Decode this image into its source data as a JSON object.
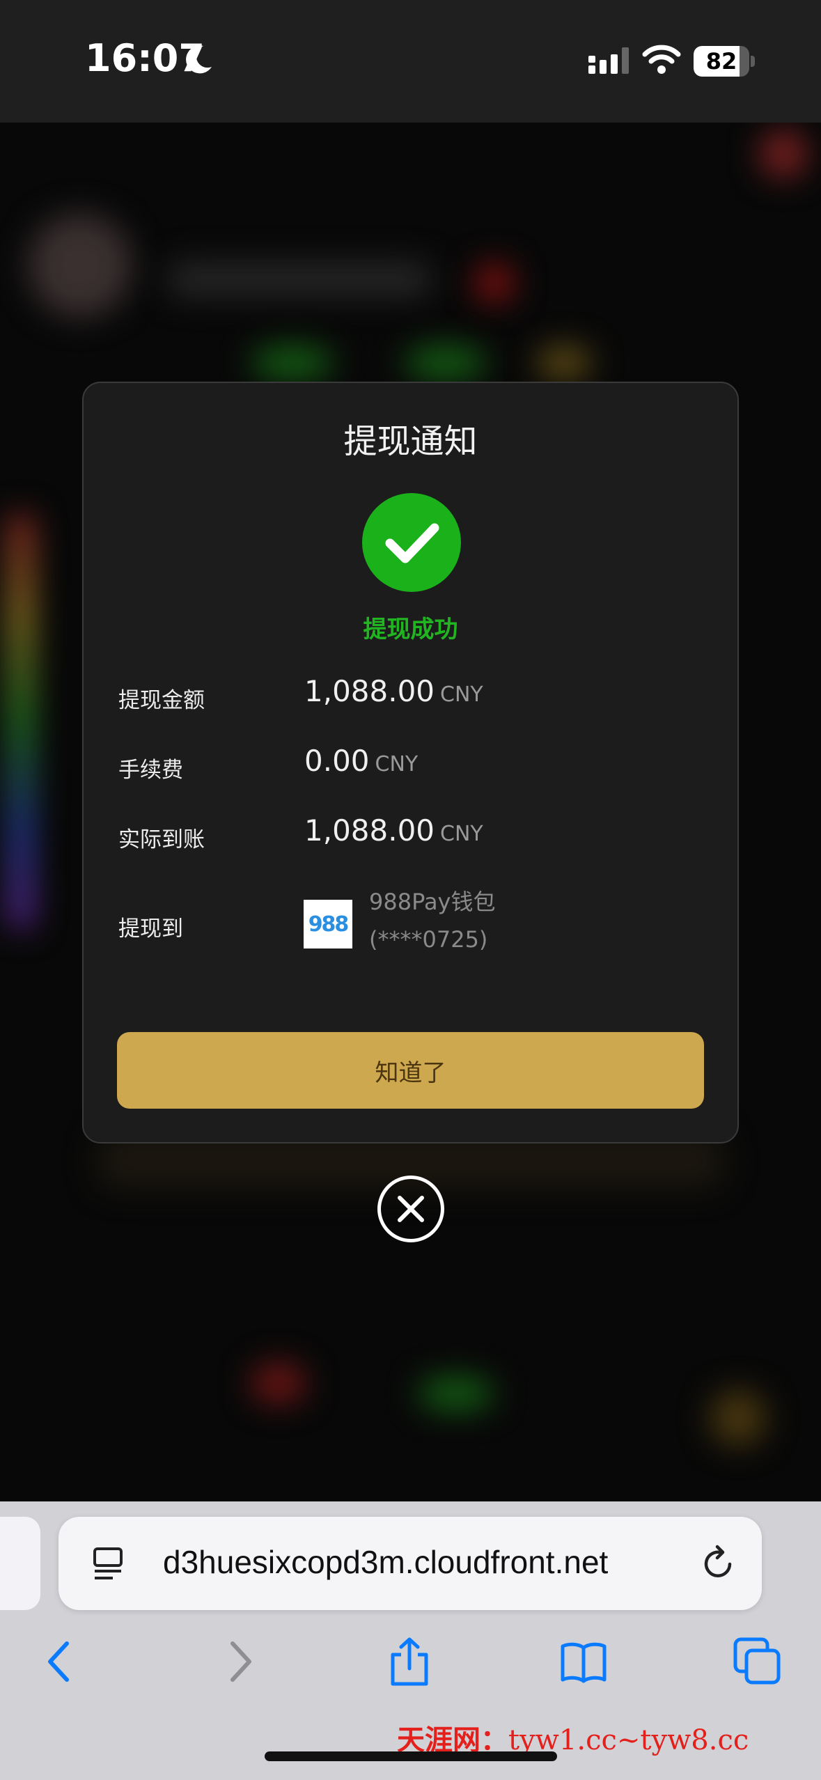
{
  "status_bar": {
    "time": "16:07",
    "battery_level": 82,
    "battery_text": "82"
  },
  "modal": {
    "title": "提现通知",
    "status_text": "提现成功",
    "rows": [
      {
        "label": "提现金额",
        "amount": "1,088.00",
        "unit": "CNY"
      },
      {
        "label": "手续费",
        "amount": "0.00",
        "unit": "CNY"
      },
      {
        "label": "实际到账",
        "amount": "1,088.00",
        "unit": "CNY"
      }
    ],
    "destination": {
      "label": "提现到",
      "wallet_logo_text": "988",
      "wallet_name": "988Pay钱包",
      "account": "(****0725)"
    },
    "confirm_label": "知道了"
  },
  "browser": {
    "url": "d3huesixcopd3m.cloudfront.net"
  },
  "watermark": {
    "brand": "天涯网：",
    "domains": "tyw1.cc~tyw8.cc"
  },
  "colors": {
    "success_green": "#1bb11b",
    "button_gold": "#cda84f",
    "modal_bg": "#1c1c1c",
    "watermark_red": "#e4201c"
  },
  "icons": [
    "moon-icon",
    "cellular-signal-icon",
    "wifi-icon",
    "battery-icon",
    "checkmark-icon",
    "close-icon",
    "reader-icon",
    "reload-icon",
    "back-icon",
    "forward-icon",
    "share-icon",
    "bookmarks-icon",
    "tabs-icon"
  ]
}
